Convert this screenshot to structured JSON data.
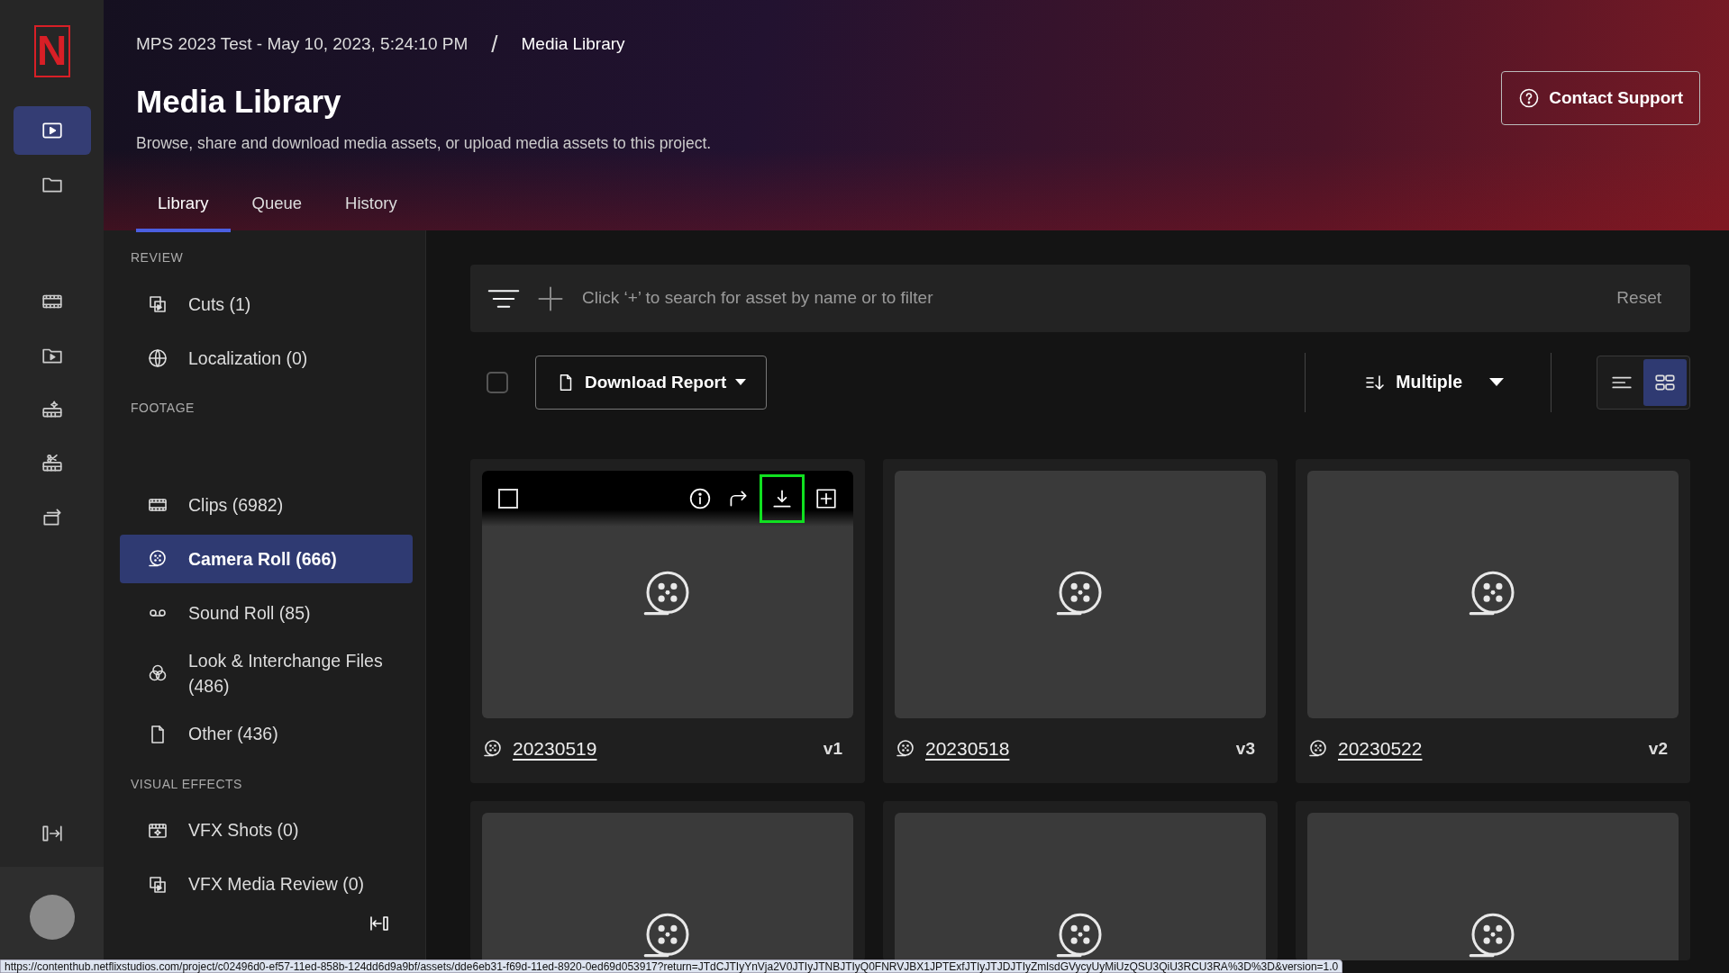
{
  "rail": {
    "logo": "N",
    "items": [
      {
        "selected": true
      },
      {
        "selected": false
      },
      {
        "selected": false
      },
      {
        "selected": false
      },
      {
        "selected": false
      },
      {
        "selected": false
      },
      {
        "selected": false
      }
    ]
  },
  "header": {
    "breadcrumb": [
      "MPS 2023 Test - May 10, 2023, 5:24:10 PM",
      "Media Library"
    ],
    "separator": "/",
    "title": "Media Library",
    "subtitle": "Browse, share and download media assets, or upload media assets to this project.",
    "contact_button": "Contact Support",
    "tabs": [
      {
        "label": "Library",
        "selected": true
      },
      {
        "label": "Queue",
        "selected": false
      },
      {
        "label": "History",
        "selected": false
      }
    ]
  },
  "sidebar": {
    "sections": [
      {
        "title": "REVIEW",
        "items": [
          {
            "label": "Cuts (1)",
            "selected": false
          },
          {
            "label": "Localization (0)",
            "selected": false
          }
        ]
      },
      {
        "title": "FOOTAGE",
        "items": [
          {
            "label": "Clips (6982)",
            "selected": false
          },
          {
            "label": "Camera Roll (666)",
            "selected": true
          },
          {
            "label": "Sound Roll (85)",
            "selected": false
          },
          {
            "label": "Look & Interchange Files (486)",
            "selected": false
          },
          {
            "label": "Other (436)",
            "selected": false
          }
        ]
      },
      {
        "title": "VISUAL EFFECTS",
        "items": [
          {
            "label": "VFX Shots (0)",
            "selected": false
          },
          {
            "label": "VFX Media Review (0)",
            "selected": false
          }
        ]
      }
    ]
  },
  "search": {
    "placeholder": "Click ‘+’ to search for asset by name or to filter",
    "reset": "Reset"
  },
  "toolbar": {
    "select_all": {
      "checked": false
    },
    "download_report": "Download Report",
    "sort": "Multiple",
    "views": [
      {
        "selected": false
      },
      {
        "selected": true
      }
    ]
  },
  "cards": [
    {
      "kind": "asset",
      "name": "20230519",
      "version": "v1",
      "checked": false,
      "actions": [
        {
          "highlighted": false
        },
        {
          "highlighted": false
        },
        {
          "highlighted": true
        },
        {
          "highlighted": false
        }
      ]
    },
    {
      "kind": "asset",
      "name": "20230518",
      "version": "v3"
    },
    {
      "kind": "asset",
      "name": "20230522",
      "version": "v2"
    },
    {
      "kind": "cut-off"
    },
    {
      "kind": "cut-off"
    },
    {
      "kind": "cut-off"
    }
  ],
  "status_url": "https://contenthub.netflixstudios.com/project/c02496d0-ef57-11ed-858b-124dd6d9a9bf/assets/dde6eb31-f69d-11ed-8920-0ed69d053917?return=JTdCJTIyYnVja2V0JTIyJTNBJTIyQ0FNRVJBX1JPTExfJTIyJTJDJTIyZmlsdGVycyUyMiUzQSU3QiU3RCU3RA%3D%3D&version=1.0"
}
